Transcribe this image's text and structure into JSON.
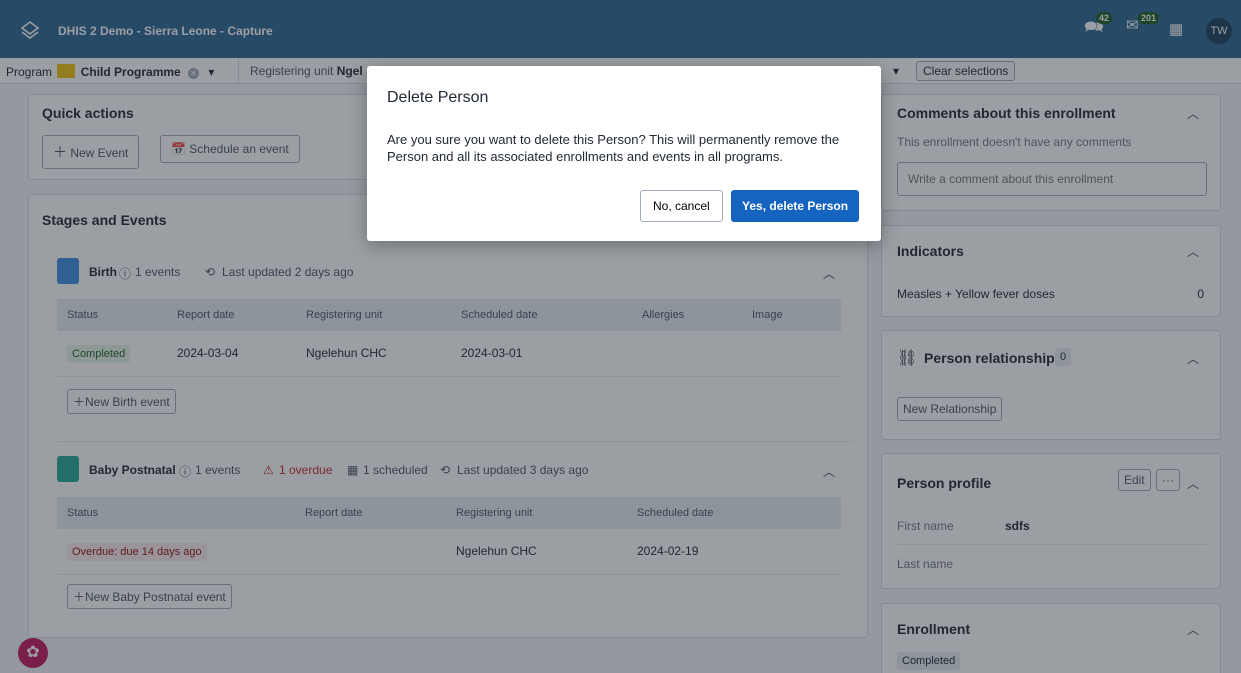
{
  "header": {
    "title": "DHIS 2 Demo - Sierra Leone - Capture",
    "interpretations_count": "42",
    "messages_count": "201",
    "avatar_initials": "TW"
  },
  "context": {
    "program_label": "Program",
    "program_value": "Child Programme",
    "org_label": "Registering unit",
    "org_value": "Ngel",
    "clear_label": "Clear selections"
  },
  "quick_actions": {
    "title": "Quick actions",
    "new_event": "New Event",
    "schedule": "Schedule an event"
  },
  "stages": {
    "title": "Stages and Events",
    "birth": {
      "name": "Birth",
      "events": "1 events",
      "updated": "Last updated 2 days ago",
      "columns": [
        "Status",
        "Report date",
        "Registering unit",
        "Scheduled date",
        "Allergies",
        "Image"
      ],
      "row": {
        "status": "Completed",
        "report": "2024-03-04",
        "unit": "Ngelehun CHC",
        "scheduled": "2024-03-01"
      },
      "new_btn": "New Birth event"
    },
    "postnatal": {
      "name": "Baby Postnatal",
      "events": "1 events",
      "overdue": "1 overdue",
      "scheduled": "1 scheduled",
      "updated": "Last updated 3 days ago",
      "columns": [
        "Status",
        "Report date",
        "Registering unit",
        "Scheduled date"
      ],
      "row": {
        "status": "Overdue: due 14 days ago",
        "unit": "Ngelehun CHC",
        "scheduled": "2024-02-19"
      },
      "new_btn": "New Baby Postnatal event"
    }
  },
  "comments": {
    "title": "Comments about this enrollment",
    "empty": "This enrollment doesn't have any comments",
    "placeholder": "Write a comment about this enrollment"
  },
  "indicators": {
    "title": "Indicators",
    "item_label": "Measles + Yellow fever doses",
    "item_value": "0"
  },
  "relationships": {
    "title": "Person relationships",
    "count": "0",
    "new_btn": "New Relationship"
  },
  "profile": {
    "title": "Person profile",
    "edit": "Edit",
    "more": "···",
    "first_name_label": "First name",
    "first_name_value": "sdfs",
    "last_name_label": "Last name"
  },
  "enrollment": {
    "title": "Enrollment",
    "status": "Completed"
  },
  "modal": {
    "title": "Delete Person",
    "body": "Are you sure you want to delete this Person? This will permanently remove the Person and all its associated enrollments and events in all programs.",
    "cancel": "No, cancel",
    "confirm": "Yes, delete Person"
  }
}
